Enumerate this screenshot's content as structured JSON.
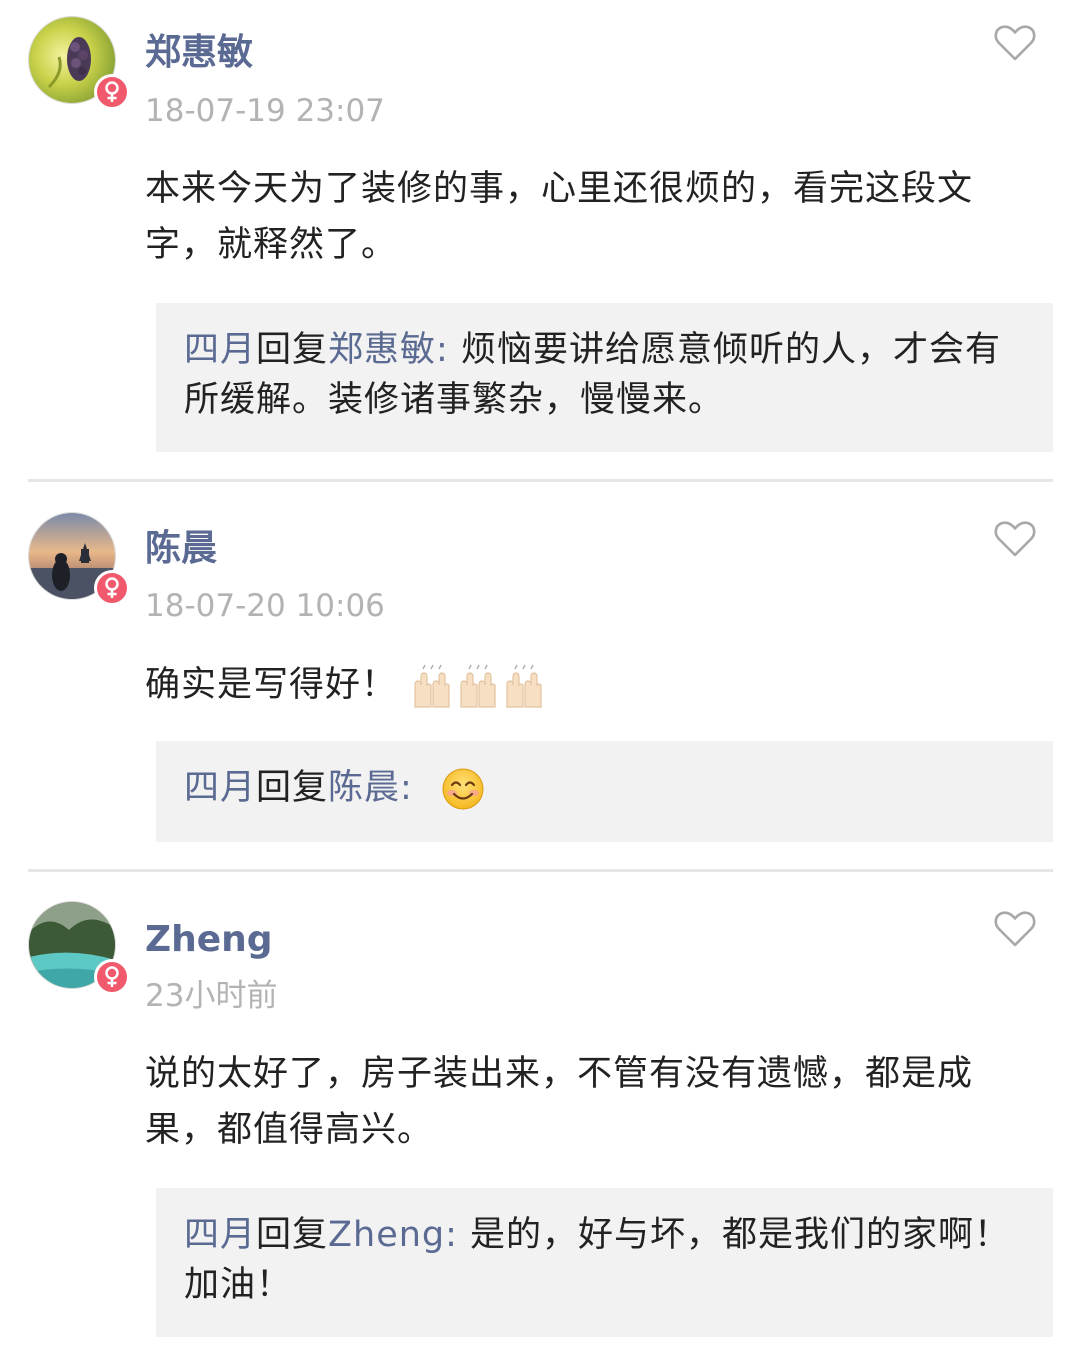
{
  "comments": [
    {
      "author": "郑惠敏",
      "time": "18-07-19 23:07",
      "text": "本来今天为了装修的事，心里还很烦的，看完这段文字，就释然了。",
      "reply": {
        "replier": "四月",
        "verb": "回复",
        "target": "郑惠敏:",
        "text": " 烦恼要讲给愿意倾听的人，才会有所缓解。装修诸事繁杂，慢慢来。"
      }
    },
    {
      "author": "陈晨",
      "time": "18-07-20 10:06",
      "text": "确实是写得好！",
      "text_emoji": "raising-hands-emoji x3",
      "reply": {
        "replier": "四月",
        "verb": "回复",
        "target": "陈晨:",
        "text": "",
        "emoji": "smiling-face-emoji"
      }
    },
    {
      "author": "Zheng",
      "time": "23小时前",
      "text": "说的太好了，房子装出来，不管有没有遗憾，都是成果，都值得高兴。",
      "reply": {
        "replier": "四月",
        "verb": "回复",
        "target": "Zheng:",
        "text": " 是的，好与坏，都是我们的家啊！加油！"
      }
    }
  ],
  "icons": {
    "like": "heart-outline-icon",
    "badge": "female-symbol-icon"
  },
  "colors": {
    "name_blue": "#5b6a92",
    "time_gray": "#b3b3b3",
    "reply_bg": "#f2f2f2",
    "badge_pink": "#f05a6c"
  }
}
